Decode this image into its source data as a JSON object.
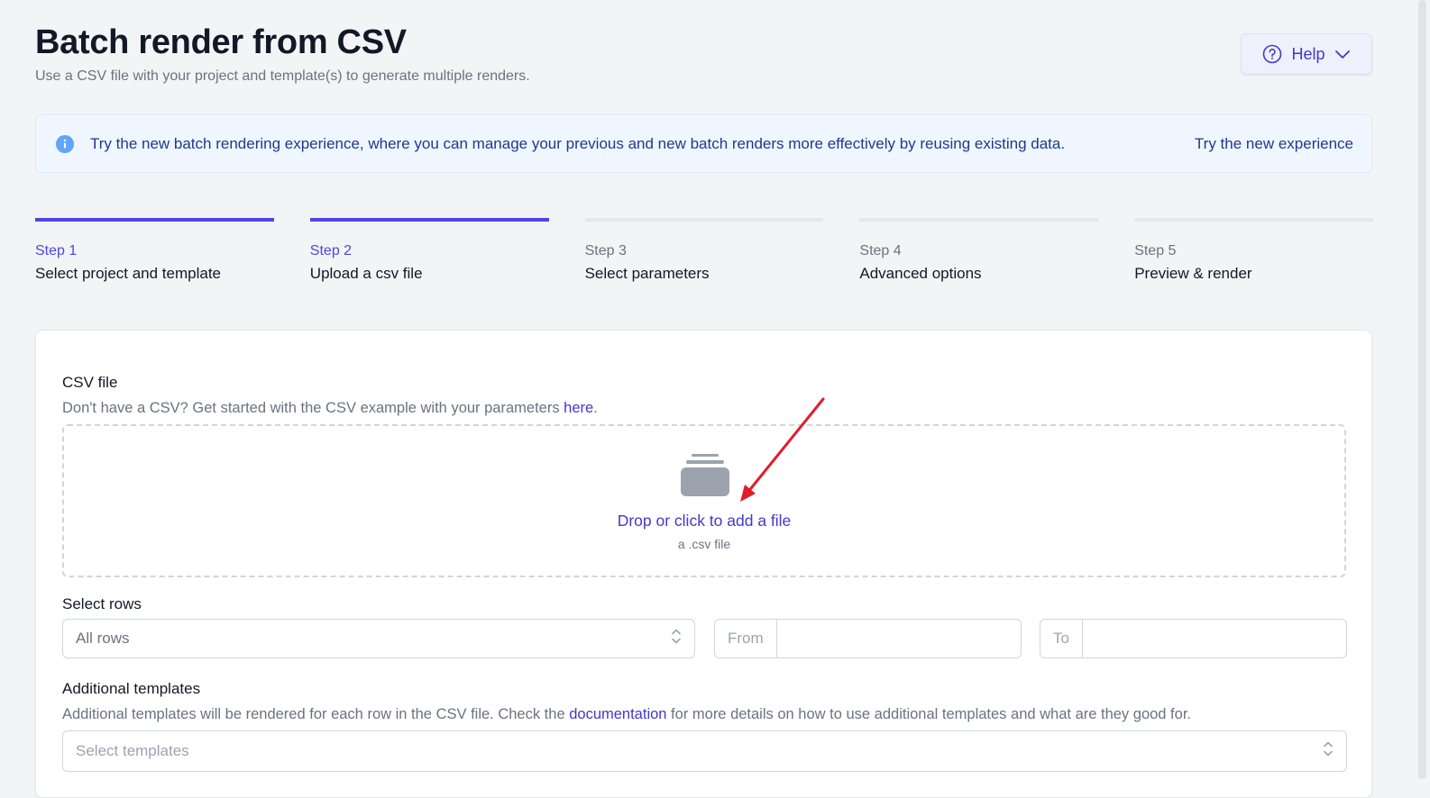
{
  "header": {
    "title": "Batch render from CSV",
    "subtitle": "Use a CSV file with your project and template(s) to generate multiple renders."
  },
  "help": {
    "label": "Help"
  },
  "banner": {
    "message": "Try the new batch rendering experience, where you can manage your previous and new batch renders more effectively by reusing existing data.",
    "cta": "Try the new experience"
  },
  "steps": [
    {
      "num": "Step 1",
      "name": "Select project and template",
      "state": "complete"
    },
    {
      "num": "Step 2",
      "name": "Upload a csv file",
      "state": "current"
    },
    {
      "num": "Step 3",
      "name": "Select parameters",
      "state": "upcoming"
    },
    {
      "num": "Step 4",
      "name": "Advanced options",
      "state": "upcoming"
    },
    {
      "num": "Step 5",
      "name": "Preview & render",
      "state": "upcoming"
    }
  ],
  "csv": {
    "label": "CSV file",
    "help_prefix": "Don't have a CSV? Get started with the CSV example with your parameters ",
    "help_link": "here",
    "help_suffix": ".",
    "drop_label": "Drop or click to add a file",
    "drop_sub": "a .csv file"
  },
  "rows": {
    "label": "Select rows",
    "selected": "All rows",
    "from_label": "From",
    "to_label": "To",
    "from_value": "",
    "to_value": ""
  },
  "templates": {
    "label": "Additional templates",
    "help_prefix": "Additional templates will be rendered for each row in the CSV file. Check the ",
    "help_link": "documentation",
    "help_suffix": " for more details on how to use additional templates and what are they good for.",
    "placeholder": "Select templates"
  },
  "colors": {
    "accent": "#4f46e5",
    "link": "#4338ca",
    "banner_bg": "#eff6ff",
    "annotation_arrow": "#e11d2a"
  }
}
